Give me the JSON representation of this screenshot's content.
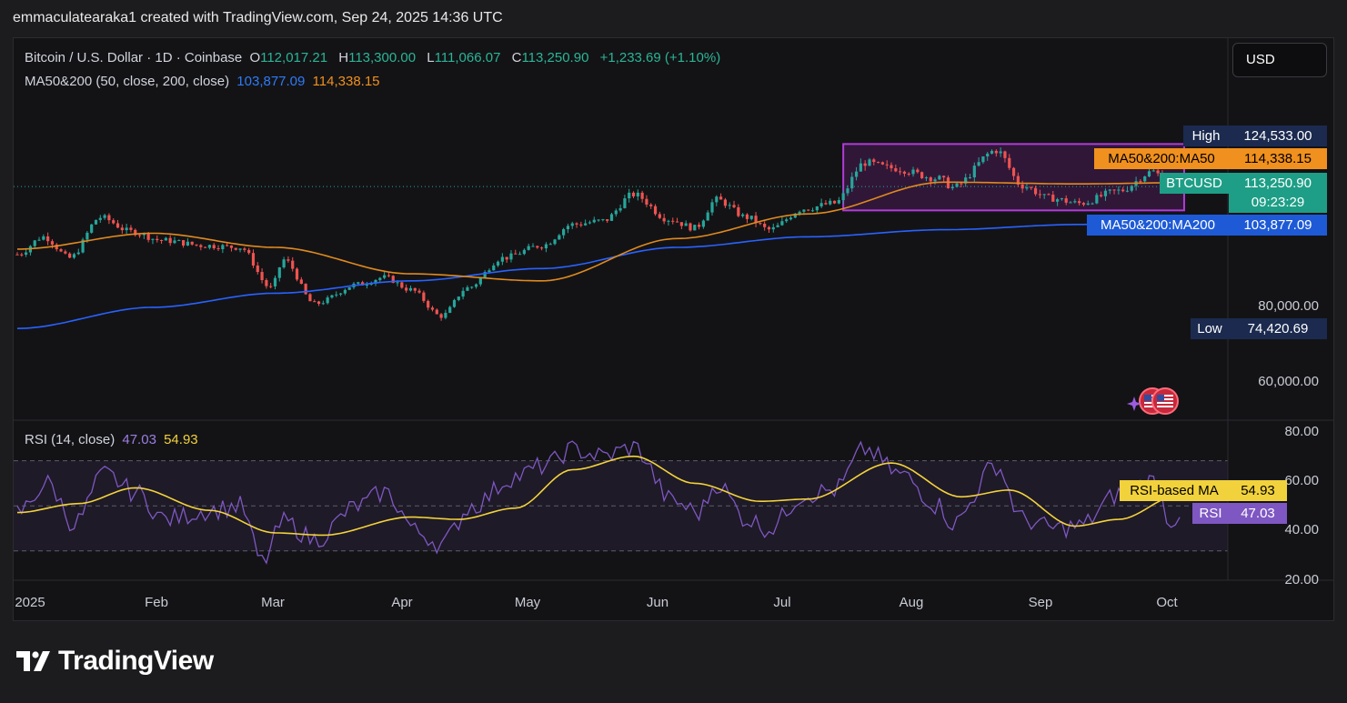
{
  "caption": "emmaculatearaka1 created with TradingView.com, Sep 24, 2025 14:36 UTC",
  "legend": {
    "symbol": "Bitcoin / U.S. Dollar · 1D · Coinbase",
    "o_label": "O",
    "o_value": "112,017.21",
    "h_label": "H",
    "h_value": "113,300.00",
    "l_label": "L",
    "l_value": "111,066.07",
    "c_label": "C",
    "c_value": "113,250.90",
    "change": "+1,233.69 (+1.10%)",
    "ma_label": "MA50&200 (50, close, 200, close)",
    "ma_short_value": "103,877.09",
    "ma_long_value": "114,338.15",
    "rsi_label": "RSI (14, close)",
    "rsi_value": "47.03",
    "rsi_ma_value": "54.93"
  },
  "currency_button": "USD",
  "tags": {
    "high_label": "High",
    "high_value": "124,533.00",
    "ma50_label": "MA50&200:MA50",
    "ma50_value": "114,338.15",
    "symbol_label": "BTCUSD",
    "price_value": "113,250.90",
    "countdown": "09:23:29",
    "ma200_label": "MA50&200:MA200",
    "ma200_value": "103,877.09",
    "low_label": "Low",
    "low_value": "74,420.69",
    "rsi_ma_label": "RSI-based MA",
    "rsi_ma_value": "54.93",
    "rsi_label": "RSI",
    "rsi_value": "47.03"
  },
  "price_axis_labels": [
    "80,000.00",
    "60,000.00"
  ],
  "rsi_axis_labels": [
    "80.00",
    "60.00",
    "40.00",
    "20.00"
  ],
  "x_axis_labels": [
    "2025",
    "Feb",
    "Mar",
    "Apr",
    "May",
    "Jun",
    "Jul",
    "Aug",
    "Sep",
    "Oct"
  ],
  "brand": "TradingView",
  "colors": {
    "up": "#26a69a",
    "down": "#ef5350",
    "ma50": "#e08a1e",
    "ma200": "#2962ff",
    "rsi": "#7e57c2",
    "rsi_ma": "#f2d23c",
    "box": "#b03cd8",
    "tag_blue": "#1e5ad6"
  },
  "chart_data": [
    {
      "type": "candlestick",
      "title": "Bitcoin / U.S. Dollar · 1D · Coinbase",
      "x": [
        "2025-01-01",
        "2025-10-05"
      ],
      "x_ticks": [
        "2025",
        "Feb",
        "Mar",
        "Apr",
        "May",
        "Jun",
        "Jul",
        "Aug",
        "Sep",
        "Oct"
      ],
      "ylim": [
        47000,
        145000
      ],
      "close_anchors": [
        [
          "2025-01-01",
          94000
        ],
        [
          "2025-01-07",
          99000
        ],
        [
          "2025-01-13",
          93000
        ],
        [
          "2025-01-20",
          104500
        ],
        [
          "2025-01-27",
          100500
        ],
        [
          "2025-02-03",
          98000
        ],
        [
          "2025-02-13",
          96500
        ],
        [
          "2025-02-21",
          96000
        ],
        [
          "2025-02-28",
          84500
        ],
        [
          "2025-03-03",
          92500
        ],
        [
          "2025-03-10",
          80000
        ],
        [
          "2025-03-20",
          85500
        ],
        [
          "2025-03-26",
          87500
        ],
        [
          "2025-04-01",
          84000
        ],
        [
          "2025-04-08",
          76500
        ],
        [
          "2025-04-14",
          84500
        ],
        [
          "2025-04-22",
          93000
        ],
        [
          "2025-05-01",
          96500
        ],
        [
          "2025-05-08",
          102500
        ],
        [
          "2025-05-15",
          103500
        ],
        [
          "2025-05-22",
          111000
        ],
        [
          "2025-05-30",
          104000
        ],
        [
          "2025-06-05",
          101500
        ],
        [
          "2025-06-10",
          109500
        ],
        [
          "2025-06-17",
          104500
        ],
        [
          "2025-06-22",
          101000
        ],
        [
          "2025-06-30",
          107000
        ],
        [
          "2025-07-07",
          108500
        ],
        [
          "2025-07-14",
          120000
        ],
        [
          "2025-07-20",
          118500
        ],
        [
          "2025-07-31",
          115500
        ],
        [
          "2025-08-03",
          113000
        ],
        [
          "2025-08-13",
          123500
        ],
        [
          "2025-08-19",
          113500
        ],
        [
          "2025-08-25",
          110000
        ],
        [
          "2025-09-01",
          108500
        ],
        [
          "2025-09-10",
          112000
        ],
        [
          "2025-09-18",
          117500
        ],
        [
          "2025-09-22",
          112600
        ],
        [
          "2025-09-24",
          113250
        ]
      ],
      "series": [
        {
          "name": "MA50&200:MA50",
          "values": [
            [
              "2025-01-01",
              95500
            ],
            [
              "2025-02-01",
              100000
            ],
            [
              "2025-03-01",
              96000
            ],
            [
              "2025-04-01",
              88500
            ],
            [
              "2025-05-01",
              86500
            ],
            [
              "2025-06-01",
              98500
            ],
            [
              "2025-07-01",
              105500
            ],
            [
              "2025-08-01",
              114500
            ],
            [
              "2025-09-01",
              114000
            ],
            [
              "2025-09-24",
              114338
            ]
          ]
        },
        {
          "name": "MA50&200:MA200",
          "values": [
            [
              "2025-01-01",
              73000
            ],
            [
              "2025-02-01",
              79000
            ],
            [
              "2025-03-01",
              83000
            ],
            [
              "2025-04-01",
              86500
            ],
            [
              "2025-05-01",
              90000
            ],
            [
              "2025-06-01",
              96000
            ],
            [
              "2025-07-01",
              99000
            ],
            [
              "2025-08-01",
              101000
            ],
            [
              "2025-09-01",
              102500
            ],
            [
              "2025-09-24",
              103877
            ]
          ]
        }
      ],
      "high": 124533.0,
      "low": 74420.69,
      "last": 113250.9,
      "highlight_range": [
        "2025-07-09",
        "2025-09-25"
      ]
    },
    {
      "type": "line",
      "title": "RSI (14, close)",
      "ylim": [
        17,
        88
      ],
      "bands": [
        30,
        50,
        70
      ],
      "series": [
        {
          "name": "RSI",
          "values": [
            [
              "2025-01-01",
              47
            ],
            [
              "2025-01-08",
              60
            ],
            [
              "2025-01-14",
              42
            ],
            [
              "2025-01-21",
              64
            ],
            [
              "2025-01-28",
              56
            ],
            [
              "2025-02-04",
              44
            ],
            [
              "2025-02-14",
              48
            ],
            [
              "2025-02-21",
              50
            ],
            [
              "2025-02-26",
              25
            ],
            [
              "2025-03-03",
              43
            ],
            [
              "2025-03-10",
              35
            ],
            [
              "2025-03-20",
              50
            ],
            [
              "2025-03-26",
              56
            ],
            [
              "2025-04-03",
              38
            ],
            [
              "2025-04-08",
              33
            ],
            [
              "2025-04-15",
              50
            ],
            [
              "2025-04-25",
              63
            ],
            [
              "2025-05-02",
              68
            ],
            [
              "2025-05-08",
              75
            ],
            [
              "2025-05-15",
              72
            ],
            [
              "2025-05-22",
              76
            ],
            [
              "2025-05-31",
              52
            ],
            [
              "2025-06-06",
              47
            ],
            [
              "2025-06-10",
              60
            ],
            [
              "2025-06-17",
              44
            ],
            [
              "2025-06-22",
              40
            ],
            [
              "2025-06-30",
              55
            ],
            [
              "2025-07-07",
              57
            ],
            [
              "2025-07-14",
              75
            ],
            [
              "2025-07-22",
              64
            ],
            [
              "2025-07-31",
              50
            ],
            [
              "2025-08-03",
              42
            ],
            [
              "2025-08-13",
              68
            ],
            [
              "2025-08-19",
              44
            ],
            [
              "2025-08-26",
              40
            ],
            [
              "2025-09-01",
              41
            ],
            [
              "2025-09-10",
              55
            ],
            [
              "2025-09-18",
              61
            ],
            [
              "2025-09-22",
              43
            ],
            [
              "2025-09-24",
              47.03
            ]
          ]
        },
        {
          "name": "RSI-based MA",
          "values": [
            [
              "2025-01-01",
              47
            ],
            [
              "2025-01-15",
              51
            ],
            [
              "2025-01-28",
              58
            ],
            [
              "2025-02-14",
              48
            ],
            [
              "2025-03-01",
              38
            ],
            [
              "2025-03-12",
              37
            ],
            [
              "2025-04-01",
              45
            ],
            [
              "2025-04-12",
              44
            ],
            [
              "2025-04-25",
              49
            ],
            [
              "2025-05-08",
              66
            ],
            [
              "2025-05-22",
              72
            ],
            [
              "2025-06-05",
              60
            ],
            [
              "2025-06-20",
              52
            ],
            [
              "2025-07-01",
              53
            ],
            [
              "2025-07-20",
              69
            ],
            [
              "2025-08-05",
              54
            ],
            [
              "2025-08-16",
              57
            ],
            [
              "2025-08-31",
              41
            ],
            [
              "2025-09-10",
              44
            ],
            [
              "2025-09-24",
              54.93
            ]
          ]
        }
      ]
    }
  ]
}
